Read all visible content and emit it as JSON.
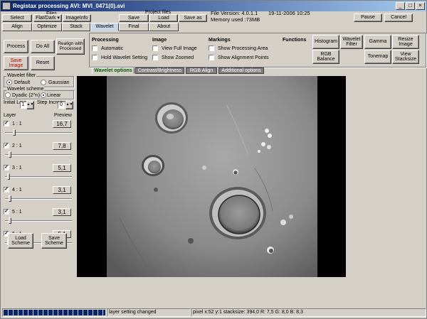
{
  "window": {
    "title": "Registax processing AVI: MVI_0471(0).avi",
    "icon_label": "RegiStax"
  },
  "menu": {
    "files_header": "Files",
    "select_label": "Select",
    "flatdark_label": "Flat/Dark ▾",
    "imageinfo_label": "ImageInfo",
    "project_files_header": "Project files",
    "save_label": "Save",
    "load_label": "Load",
    "saveas_label": "Save as",
    "file_version": "File Version: 4.0.1.1",
    "date_time": "19-11-2006 10:25",
    "memory_used": "Memory used :73MB",
    "pause_label": "Pause",
    "cancel_label": "Cancel"
  },
  "tabs": [
    "Align",
    "Optimize",
    "Stack",
    "Wavelet",
    "Final",
    "About"
  ],
  "active_tab": "Wavelet",
  "actions": {
    "process_label": "Process",
    "doall_label": "Do All",
    "realign_label": "Realign with Processed",
    "saveimage_label": "Save Image",
    "reset_label": "Reset"
  },
  "processing": {
    "header": "Processing",
    "automatic_label": "Automatic",
    "automatic_checked": false,
    "hold_label": "Hold Wavelet Setting",
    "hold_checked": false
  },
  "image_opts": {
    "header": "Image",
    "fullimage_label": "View Full Image",
    "fullimage_checked": false,
    "zoomed_label": "Show Zoomed",
    "zoomed_checked": false
  },
  "markings": {
    "header": "Markings",
    "area_label": "Show Processing Area",
    "area_checked": false,
    "align_label": "Show Alignment Points",
    "align_checked": false
  },
  "functions": {
    "header": "Functions",
    "histogram_label": "Histogram",
    "waveletfilter_label": "Wavelet Filter",
    "gamma_label": "Gamma",
    "resize_label": "Resize Image",
    "rgbbalance_label": "RGB Balance",
    "tonemap_label": "Tonemap",
    "stacksize_label": "View Stacksize"
  },
  "subtabs": [
    "Wavelet options",
    "Contrast/Brightness",
    "RGB Align",
    "Additional options"
  ],
  "active_subtab": "Wavelet options",
  "wavelet_filter": {
    "header": "Wavelet filter",
    "default_label": "Default",
    "gaussian_label": "Gaussian",
    "selected": "Default"
  },
  "wavelet_scheme": {
    "header": "Wavelet scheme",
    "dyadic_label": "Dyadic (2^n)",
    "linear_label": "Linear",
    "selected": "Linear"
  },
  "layer_settings": {
    "initial_layer_label": "Initial Layer",
    "initial_layer_value": "1",
    "step_increment_label": "Step Increment",
    "step_increment_value": "0"
  },
  "layers": {
    "layer_header": "Layer",
    "preview_header": "Preview",
    "items": [
      {
        "label": "1 : 1",
        "checked": true,
        "preview": "16,7",
        "slider": 0.12
      },
      {
        "label": "2 : 1",
        "checked": true,
        "preview": "7,8",
        "slider": 0.06
      },
      {
        "label": "3 : 1",
        "checked": true,
        "preview": "5,1",
        "slider": 0.03
      },
      {
        "label": "4 : 1",
        "checked": true,
        "preview": "3,1",
        "slider": 0.06
      },
      {
        "label": "5 : 1",
        "checked": true,
        "preview": "3,1",
        "slider": 0.06
      },
      {
        "label": "6 : 1",
        "checked": true,
        "preview": "5,1",
        "slider": 0.03
      }
    ]
  },
  "schemes": {
    "load_label": "Load Scheme",
    "save_label": "Save Scheme"
  },
  "status": {
    "progress": 1.0,
    "message": "layer setting changed",
    "pixel_info": "pixel x:52 y:1 stacksize: 394,0 R: 7,5 G: 8,0 B: 8,3"
  },
  "colors": {
    "title_start": "#0a246a",
    "title_end": "#a6caf0",
    "active_tab": "#c8d8e8",
    "save_image_text": "#c00000",
    "progress": "#0a246a",
    "subtab_active_text": "#006000"
  }
}
